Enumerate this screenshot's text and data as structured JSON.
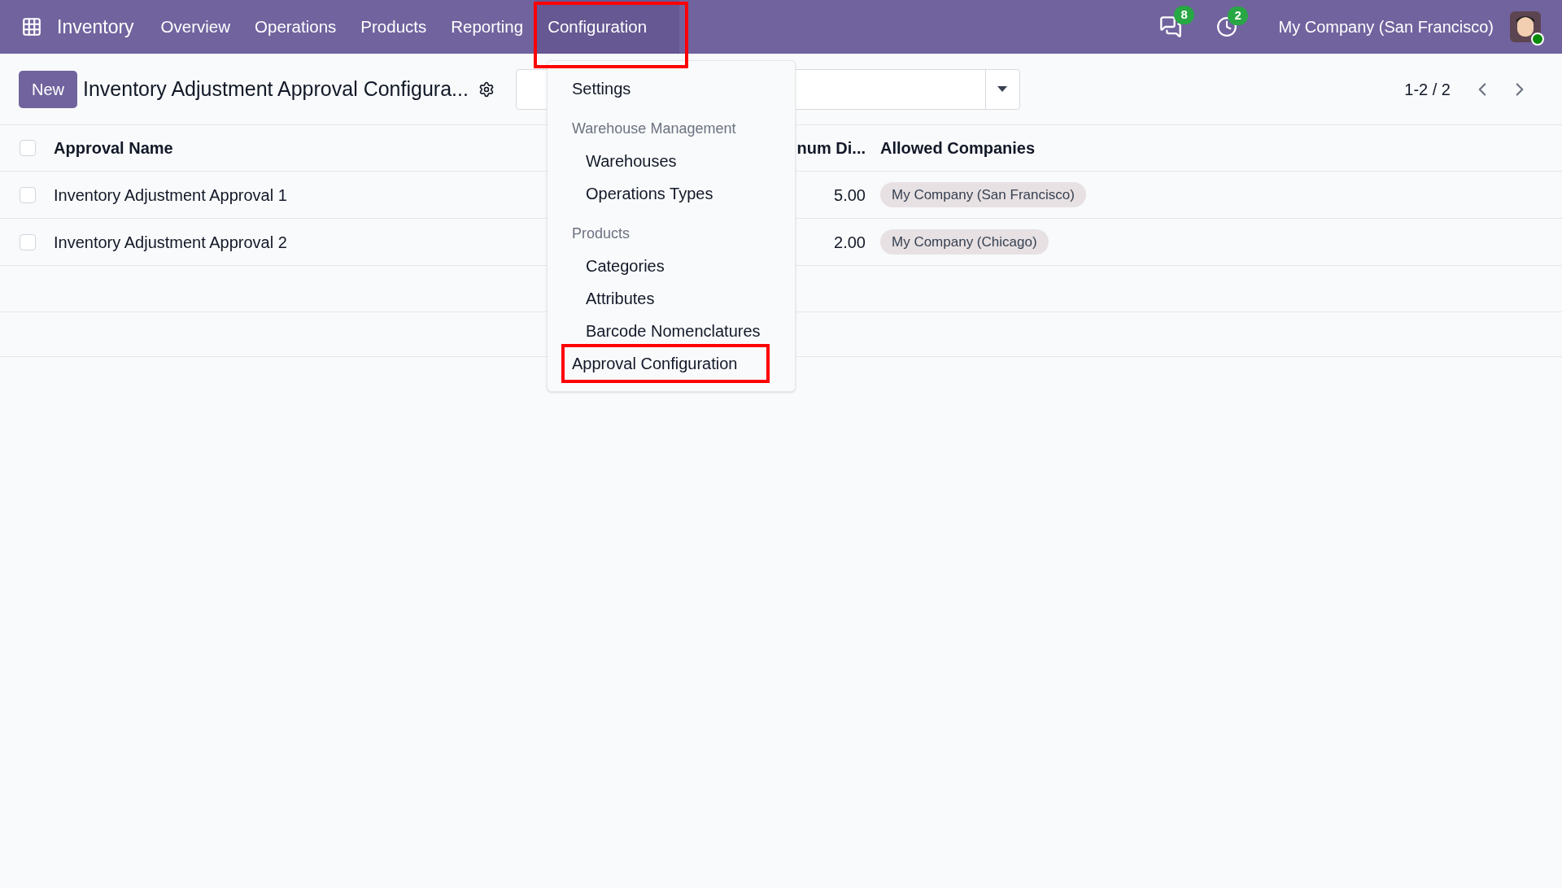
{
  "navbar": {
    "app_name": "Inventory",
    "menu": [
      {
        "label": "Overview",
        "selected": false,
        "highlighted": false
      },
      {
        "label": "Operations",
        "selected": false,
        "highlighted": false
      },
      {
        "label": "Products",
        "selected": false,
        "highlighted": false
      },
      {
        "label": "Reporting",
        "selected": false,
        "highlighted": false
      },
      {
        "label": "Configuration",
        "selected": true,
        "highlighted": true
      }
    ],
    "messages_badge": "8",
    "activities_badge": "2",
    "company": "My Company (San Francisco)"
  },
  "control_panel": {
    "new_button": "New",
    "title": "Inventory Adjustment Approval Configura...",
    "pager": "1-2 / 2"
  },
  "table": {
    "all_checked": false,
    "columns": [
      "Approval Name",
      "num Di...",
      "Allowed Companies"
    ],
    "rows": [
      {
        "name": "Inventory Adjustment Approval 1",
        "value": "5.00",
        "companies": [
          "My Company (San Francisco)"
        ],
        "checked": false
      },
      {
        "name": "Inventory Adjustment Approval 2",
        "value": "2.00",
        "companies": [
          "My Company (Chicago)"
        ],
        "checked": false
      }
    ]
  },
  "dropdown": [
    {
      "kind": "item",
      "label": "Settings",
      "highlighted": false
    },
    {
      "kind": "header",
      "label": "Warehouse Management"
    },
    {
      "kind": "subitem",
      "label": "Warehouses",
      "highlighted": false
    },
    {
      "kind": "subitem",
      "label": "Operations Types",
      "highlighted": false
    },
    {
      "kind": "header",
      "label": "Products"
    },
    {
      "kind": "subitem",
      "label": "Categories",
      "highlighted": false
    },
    {
      "kind": "subitem",
      "label": "Attributes",
      "highlighted": false
    },
    {
      "kind": "subitem",
      "label": "Barcode Nomenclatures",
      "highlighted": false
    },
    {
      "kind": "item",
      "label": "Approval Configuration",
      "highlighted": true
    }
  ]
}
